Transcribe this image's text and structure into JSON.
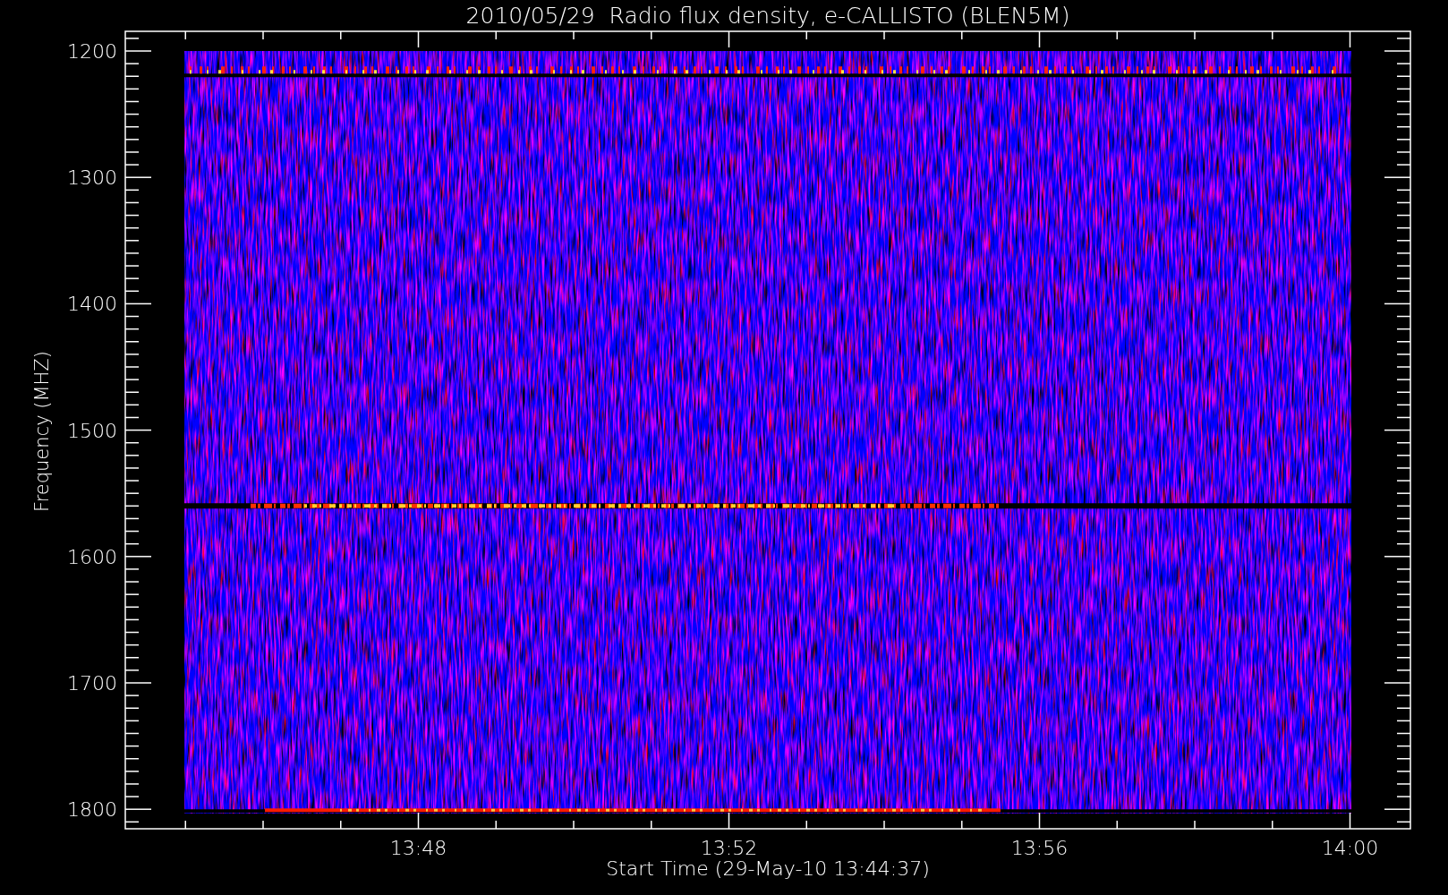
{
  "plot": {
    "title": "2010/05/29  Radio flux density, e-CALLISTO (BLEN5M)",
    "ylabel": "Frequency (MHZ)",
    "xlabel": "Start Time (29-May-10 13:44:37)",
    "yticks": [
      "1200",
      "1300",
      "1400",
      "1500",
      "1600",
      "1700",
      "1800"
    ],
    "xticks": [
      "13:48",
      "13:52",
      "13:56",
      "14:00"
    ]
  }
}
